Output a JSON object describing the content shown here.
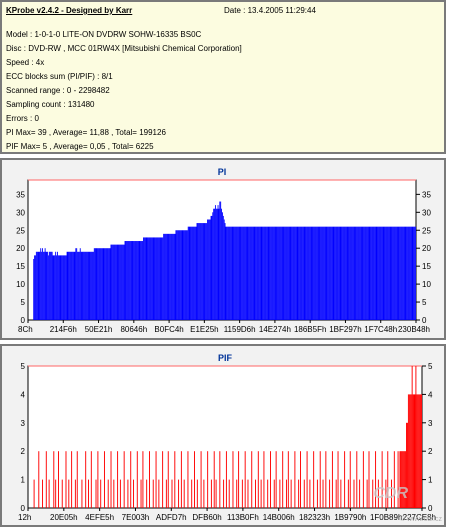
{
  "header": {
    "app_title": "KProbe v2.4.2 - Designed by Karr",
    "date": "Date : 13.4.2005 11:29:44",
    "lines": [
      "Model : 1-0-1-0 LITE-ON DVDRW SOHW-16335 BS0C",
      "Disc : DVD-RW , MCC 01RW4X  [Mitsubishi Chemical Corporation]",
      "Speed : 4x",
      "ECC blocks sum (PI/PIF) : 8/1",
      "Scanned range : 0 - 2298482",
      "Sampling count : 131480",
      "Errors : 0",
      "PI Max= 39 , Average= 11,88 , Total= 199126",
      "PIF Max= 5 , Average= 0,05 , Total= 6225"
    ]
  },
  "watermark": "CDR",
  "watermark_url": "© www.cdr.cz",
  "chart_data": [
    {
      "type": "bar",
      "title": "PI",
      "ylim": [
        0,
        39
      ],
      "yticks": [
        0,
        5,
        10,
        15,
        20,
        25,
        30,
        35
      ],
      "xticks": [
        "8Ch",
        "214F6h",
        "50E21h",
        "80646h",
        "B0FC4h",
        "E1E25h",
        "1159D6h",
        "14E274h",
        "186B5Fh",
        "1BF297h",
        "1F7C48h",
        "230B48h"
      ],
      "color": "#0000ff",
      "series": [
        {
          "values": [
            0,
            0,
            0,
            0,
            0,
            0,
            17,
            18,
            18,
            19,
            19,
            19,
            19,
            19,
            20,
            19,
            20,
            19,
            19,
            20,
            19,
            19,
            19,
            18,
            19,
            19,
            19,
            19,
            18,
            18,
            18,
            19,
            18,
            19,
            18,
            18,
            18,
            18,
            18,
            18,
            18,
            18,
            18,
            18,
            19,
            19,
            19,
            19,
            19,
            19,
            19,
            19,
            19,
            19,
            20,
            20,
            19,
            19,
            19,
            20,
            19,
            19,
            19,
            19,
            19,
            19,
            19,
            19,
            19,
            19,
            19,
            19,
            19,
            19,
            19,
            20,
            20,
            20,
            20,
            20,
            20,
            20,
            20,
            20,
            20,
            20,
            20,
            20,
            20,
            20,
            20,
            20,
            20,
            20,
            21,
            21,
            21,
            21,
            21,
            21,
            21,
            21,
            21,
            21,
            21,
            21,
            21,
            21,
            21,
            21,
            22,
            22,
            22,
            22,
            22,
            22,
            22,
            22,
            22,
            22,
            22,
            22,
            22,
            22,
            22,
            22,
            22,
            22,
            22,
            22,
            22,
            23,
            23,
            23,
            23,
            23,
            23,
            23,
            23,
            23,
            23,
            23,
            23,
            23,
            23,
            23,
            23,
            23,
            23,
            23,
            23,
            23,
            23,
            23,
            24,
            24,
            24,
            24,
            24,
            24,
            24,
            24,
            24,
            24,
            24,
            24,
            24,
            24,
            25,
            25,
            25,
            25,
            25,
            25,
            25,
            25,
            25,
            25,
            25,
            25,
            25,
            25,
            26,
            26,
            26,
            26,
            26,
            26,
            26,
            26,
            26,
            26,
            27,
            27,
            27,
            27,
            27,
            27,
            27,
            27,
            27,
            27,
            27,
            27,
            28,
            28,
            28,
            28,
            29,
            29,
            30,
            31,
            31,
            32,
            31,
            31,
            32,
            31,
            33,
            33,
            31,
            30,
            29,
            28,
            27,
            26,
            26,
            26,
            26,
            26,
            26,
            26,
            26,
            26,
            26,
            26,
            26,
            26,
            26,
            26,
            26,
            26,
            26,
            26,
            26,
            26,
            26,
            26,
            26,
            26,
            26,
            26,
            26,
            26,
            26,
            26,
            26,
            26,
            26,
            26,
            26,
            26,
            26,
            26,
            26,
            26,
            26,
            26,
            26,
            26,
            26,
            26,
            26,
            26,
            26,
            26,
            26,
            26,
            26,
            26,
            26,
            26,
            26,
            26,
            26,
            26,
            26,
            26,
            26,
            26,
            26,
            26,
            26,
            26,
            26,
            26,
            26,
            26,
            26,
            26,
            26,
            26,
            26,
            26,
            26,
            26,
            26,
            26,
            26,
            26,
            26,
            26,
            26,
            26,
            26,
            26,
            26,
            26,
            26,
            26,
            26,
            26,
            26,
            26,
            26,
            26,
            26,
            26,
            26,
            26,
            26,
            26,
            26,
            26,
            26,
            26,
            26,
            26,
            26,
            26,
            26,
            26,
            26,
            26,
            26,
            26,
            26,
            26,
            26,
            26,
            26,
            26,
            26,
            26,
            26,
            26,
            26,
            26,
            26,
            26,
            26,
            26,
            26,
            26,
            26,
            26,
            26,
            26,
            26,
            26,
            26,
            26,
            26,
            26,
            26,
            26,
            26,
            26,
            26,
            26,
            26,
            26,
            26,
            26,
            26,
            26,
            26,
            26,
            26,
            26,
            26,
            26,
            26,
            26,
            26,
            26,
            26,
            26,
            26,
            26,
            26,
            26,
            26,
            26,
            26,
            26,
            26,
            26,
            26,
            26,
            26,
            26,
            26,
            26,
            26,
            26,
            26,
            26,
            26,
            26,
            26,
            26,
            26,
            26,
            26,
            26,
            26,
            26,
            26,
            26,
            26,
            26,
            26,
            26,
            26,
            26,
            26,
            26,
            26,
            26,
            26,
            26
          ]
        }
      ]
    },
    {
      "type": "bar",
      "title": "PIF",
      "ylim": [
        0,
        5
      ],
      "yticks": [
        0,
        1,
        2,
        3,
        4,
        5
      ],
      "xticks": [
        "12h",
        "20E05h",
        "4EFE5h",
        "7E003h",
        "ADFD7h",
        "DFB60h",
        "113B0Fh",
        "14B006h",
        "182323h",
        "1B9790h",
        "1F0B89h",
        "227CE8h"
      ],
      "color": "#ff0000",
      "series": [
        {
          "values": [
            0,
            0,
            0,
            0,
            0,
            0,
            1,
            0,
            0,
            0,
            0,
            2,
            0,
            0,
            0,
            1,
            0,
            0,
            0,
            2,
            0,
            0,
            1,
            0,
            0,
            0,
            0,
            2,
            0,
            1,
            0,
            0,
            2,
            0,
            0,
            0,
            1,
            0,
            0,
            0,
            2,
            0,
            0,
            1,
            0,
            0,
            2,
            0,
            0,
            0,
            1,
            0,
            2,
            0,
            0,
            0,
            0,
            1,
            0,
            0,
            0,
            2,
            0,
            0,
            1,
            0,
            0,
            2,
            0,
            0,
            0,
            0,
            1,
            0,
            2,
            0,
            0,
            1,
            0,
            0,
            0,
            2,
            0,
            0,
            0,
            1,
            0,
            0,
            2,
            0,
            0,
            1,
            0,
            0,
            0,
            2,
            0,
            0,
            1,
            0,
            0,
            0,
            2,
            0,
            0,
            0,
            1,
            0,
            0,
            2,
            0,
            0,
            1,
            0,
            0,
            0,
            2,
            0,
            0,
            0,
            1,
            0,
            2,
            0,
            0,
            0,
            1,
            0,
            0,
            2,
            0,
            0,
            0,
            1,
            0,
            0,
            2,
            0,
            0,
            1,
            0,
            0,
            0,
            2,
            0,
            0,
            0,
            1,
            0,
            2,
            0,
            0,
            0,
            1,
            0,
            0,
            2,
            0,
            0,
            0,
            1,
            0,
            0,
            2,
            0,
            0,
            1,
            0,
            0,
            0,
            2,
            0,
            0,
            0,
            1,
            0,
            0,
            2,
            0,
            0,
            1,
            0,
            0,
            0,
            2,
            0,
            0,
            1,
            0,
            0,
            0,
            2,
            0,
            0,
            0,
            1,
            0,
            0,
            2,
            0,
            1,
            0,
            0,
            0,
            2,
            0,
            0,
            0,
            1,
            0,
            0,
            2,
            0,
            0,
            1,
            0,
            0,
            0,
            2,
            0,
            0,
            0,
            1,
            0,
            2,
            0,
            0,
            0,
            1,
            0,
            0,
            2,
            0,
            0,
            1,
            0,
            0,
            0,
            2,
            0,
            0,
            0,
            1,
            0,
            0,
            2,
            0,
            0,
            1,
            0,
            0,
            2,
            0,
            0,
            0,
            1,
            0,
            0,
            2,
            0,
            0,
            0,
            1,
            0,
            2,
            0,
            0,
            0,
            1,
            0,
            0,
            2,
            0,
            0,
            0,
            1,
            0,
            2,
            0,
            0,
            1,
            0,
            0,
            0,
            2,
            0,
            0,
            0,
            1,
            0,
            2,
            0,
            0,
            0,
            1,
            0,
            0,
            2,
            0,
            0,
            1,
            0,
            0,
            0,
            2,
            0,
            0,
            0,
            1,
            0,
            0,
            2,
            0,
            0,
            1,
            0,
            0,
            2,
            0,
            0,
            0,
            1,
            0,
            0,
            2,
            0,
            0,
            0,
            1,
            0,
            2,
            0,
            0,
            1,
            0,
            0,
            0,
            2,
            0,
            0,
            0,
            1,
            0,
            2,
            0,
            0,
            0,
            1,
            0,
            0,
            2,
            0,
            0,
            1,
            0,
            0,
            0,
            2,
            0,
            0,
            0,
            1,
            0,
            2,
            0,
            0,
            0,
            1,
            0,
            0,
            2,
            0,
            0,
            1,
            0,
            0,
            0,
            2,
            0,
            0,
            0,
            1,
            0,
            2,
            0,
            0,
            0,
            1,
            0,
            0,
            2,
            0,
            0,
            0,
            2,
            0,
            2,
            2,
            2,
            2,
            2,
            2,
            2,
            3,
            3,
            4,
            4,
            4,
            4,
            5,
            4,
            4,
            4,
            5,
            4,
            4,
            4,
            4,
            4,
            4
          ]
        }
      ]
    }
  ]
}
